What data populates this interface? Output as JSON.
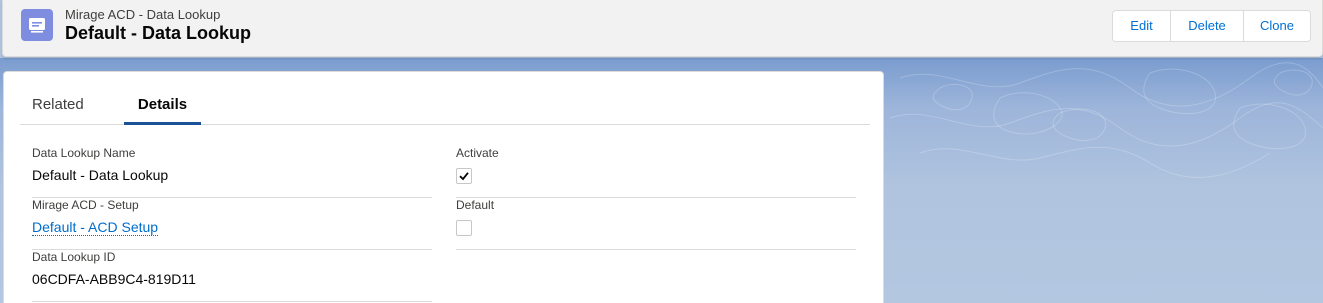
{
  "header": {
    "object_type": "Mirage ACD - Data Lookup",
    "record_name": "Default - Data Lookup",
    "icon": "record-icon",
    "actions": {
      "edit": "Edit",
      "delete": "Delete",
      "clone": "Clone"
    }
  },
  "tabs": [
    {
      "label": "Related",
      "selected": false
    },
    {
      "label": "Details",
      "selected": true
    }
  ],
  "fields": {
    "data_lookup_name": {
      "label": "Data Lookup Name",
      "value": "Default - Data Lookup"
    },
    "mirage_acd_setup": {
      "label": "Mirage ACD - Setup",
      "value": "Default - ACD Setup"
    },
    "data_lookup_id": {
      "label": "Data Lookup ID",
      "value": "06CDFA-ABB9C4-819D11"
    },
    "activate": {
      "label": "Activate",
      "checked": true
    },
    "default": {
      "label": "Default",
      "checked": false
    }
  },
  "colors": {
    "link": "#006dcc",
    "tab_active_underline": "#1b5297",
    "object_icon_bg": "#7f8de1",
    "background": "#b0c4df"
  }
}
